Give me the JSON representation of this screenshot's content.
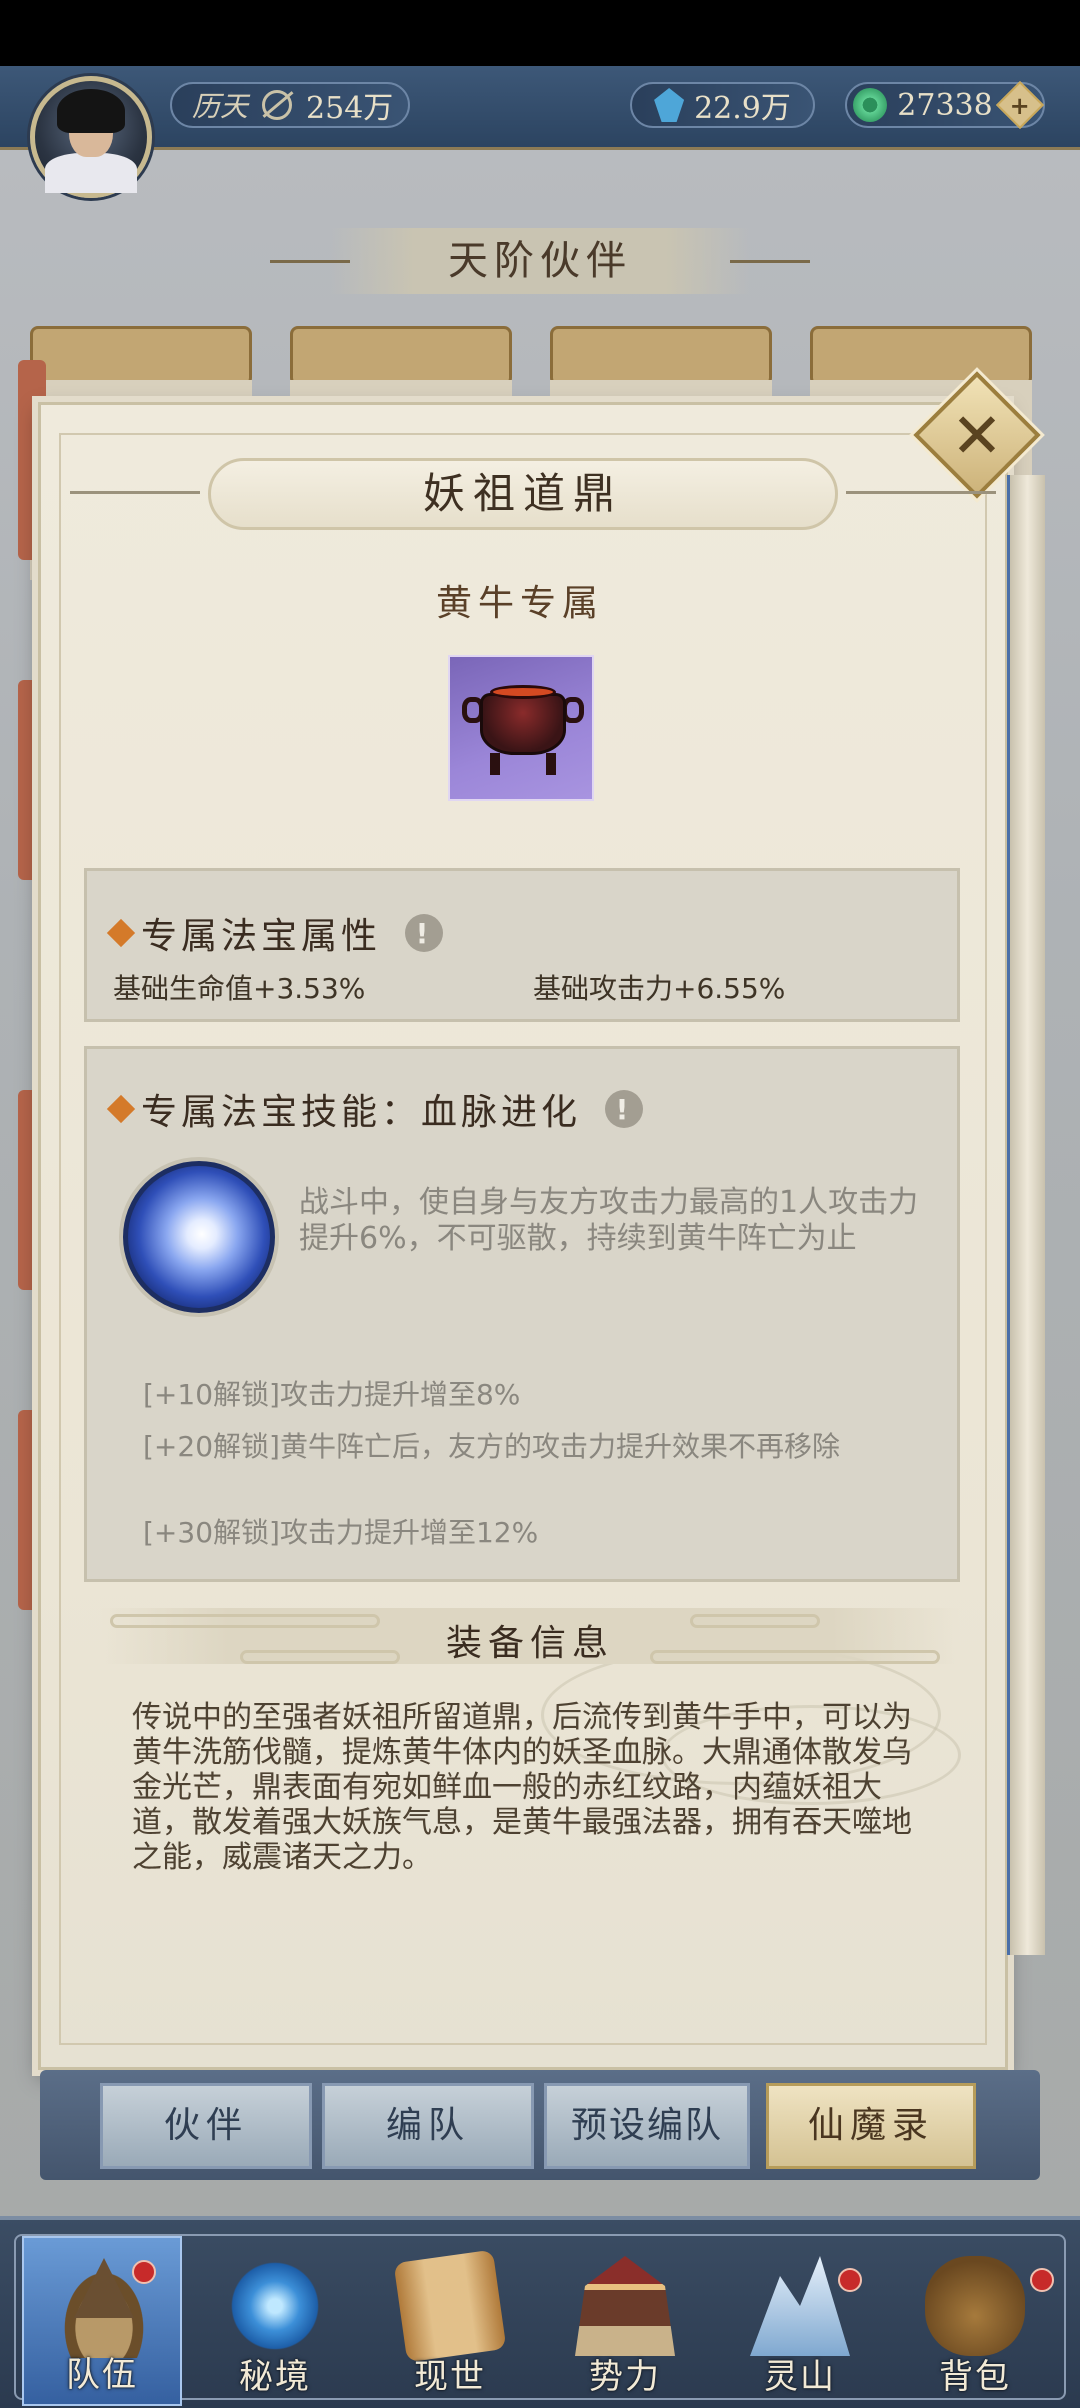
{
  "topbar": {
    "power_label": "历天",
    "power_value": "254万",
    "crystal_value": "22.9万",
    "jade_value": "27338",
    "plus_symbol": "+",
    "colors": {
      "bar": "#2c4461",
      "accent_gold": "#c9a85a"
    }
  },
  "background": {
    "section_title": "天阶伙伴"
  },
  "modal": {
    "title": "妖祖道鼎",
    "close_symbol": "✕",
    "owner_tag": "黄牛专属",
    "item_icon": "cauldron-icon",
    "attributes": {
      "heading": "专属法宝属性",
      "info_symbol": "!",
      "hp_bonus": "基础生命值+3.53%",
      "atk_bonus": "基础攻击力+6.55%"
    },
    "skill": {
      "heading": "专属法宝技能：血脉进化",
      "info_symbol": "!",
      "icon": "energy-orb-icon",
      "description": "战斗中，使自身与友方攻击力最高的1人攻击力提升6%，不可驱散，持续到黄牛阵亡为止",
      "unlocks": [
        {
          "tag": "[+10解锁]",
          "text": "攻击力提升增至8%"
        },
        {
          "tag": "[+20解锁]",
          "text": "黄牛阵亡后，友方的攻击力提升效果不再移除"
        },
        {
          "tag": "[+30解锁]",
          "text": "攻击力提升增至12%"
        }
      ]
    },
    "equipment": {
      "heading": "装备信息",
      "description": "传说中的至强者妖祖所留道鼎，后流传到黄牛手中，可以为黄牛洗筋伐髓，提炼黄牛体内的妖圣血脉。大鼎通体散发乌金光芒，鼎表面有宛如鲜血一般的赤红纹路，内蕴妖祖大道，散发着强大妖族气息，是黄牛最强法器，拥有吞天噬地之能，威震诸天之力。"
    }
  },
  "tabs": [
    {
      "label": "伙伴",
      "active": false
    },
    {
      "label": "编队",
      "active": false
    },
    {
      "label": "预设编队",
      "active": false
    },
    {
      "label": "仙魔录",
      "active": true
    }
  ],
  "nav": [
    {
      "label": "队伍",
      "icon": "hat-icon",
      "active": true,
      "badge": true
    },
    {
      "label": "秘境",
      "icon": "portal-icon",
      "active": false,
      "badge": false
    },
    {
      "label": "现世",
      "icon": "scroll-icon",
      "active": false,
      "badge": false
    },
    {
      "label": "势力",
      "icon": "temple-icon",
      "active": false,
      "badge": false
    },
    {
      "label": "灵山",
      "icon": "mountain-icon",
      "active": false,
      "badge": true
    },
    {
      "label": "背包",
      "icon": "bag-icon",
      "active": false,
      "badge": true
    }
  ]
}
